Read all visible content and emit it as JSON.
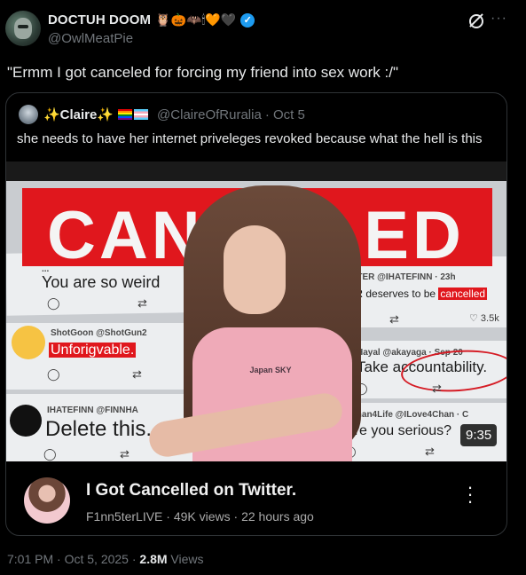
{
  "author": {
    "display_name": "DOCTUH DOOM",
    "emojis": "🦉🎃🦇🕯🧡🖤",
    "handle": "@OwlMeatPie"
  },
  "tweet": {
    "text": "\"Ermm I got canceled for forcing my friend into sex work :/\""
  },
  "quote": {
    "display_name": "✨Claire✨",
    "handle": "@ClaireOfRuralia",
    "date": "· Oct 5",
    "text": "she needs to have her internet priveleges revoked because what the hell is this"
  },
  "thumbnail": {
    "banner": "CAN  ELLED",
    "comments": {
      "c1_name": "...",
      "c1_text": "You are so weird",
      "c2_name": "ANTIFINNSTER @IHATEFINN · 23h",
      "c2_text_pre": "F1NN5TER deserves to be",
      "c2_highlight": "cancelled",
      "c2_likes": "3.5k",
      "c3_name": "ShotGoon @ShotGun2",
      "c3_text": "Unforigvable.",
      "c4_name": "Hayal @akayaga · Sep 20",
      "c4_text": "Take accountability.",
      "c5_name": "IHATEFINN @FINNHA",
      "c5_text": "Delete this.",
      "c6_name": "4Chan4Life @ILove4Chan · C",
      "c6_text": "Are you serious?"
    },
    "shirt_print": "Japan SKY",
    "duration": "9:35"
  },
  "video": {
    "title": "I Got Cancelled on Twitter.",
    "channel": "F1nn5terLIVE",
    "views": "· 49K views",
    "age": "· 22 hours ago"
  },
  "footer": {
    "time": "7:01 PM",
    "date": "· Oct 5, 2025 ·",
    "views_count": "2.8M",
    "views_label": "Views"
  },
  "colors": {
    "accent": "#1d9bf0",
    "banner_red": "#e0171d"
  }
}
